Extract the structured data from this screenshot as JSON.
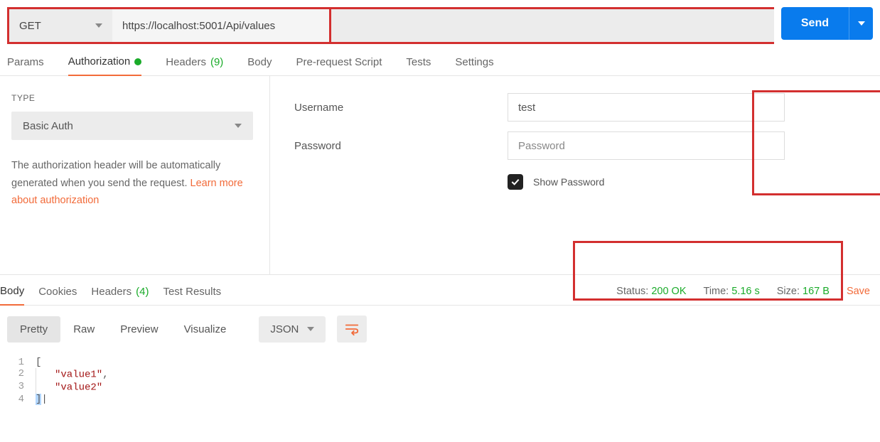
{
  "request": {
    "method": "GET",
    "url": "https://localhost:5001/Api/values",
    "send_label": "Send"
  },
  "tabs": {
    "params": "Params",
    "authorization": "Authorization",
    "headers": "Headers",
    "headers_count": "(9)",
    "body": "Body",
    "prerequest": "Pre-request Script",
    "tests": "Tests",
    "settings": "Settings"
  },
  "auth": {
    "type_label": "TYPE",
    "type_value": "Basic Auth",
    "desc1": "The authorization header will be automatically generated when you send the request. ",
    "learn": "Learn more about authorization",
    "username_label": "Username",
    "username_value": "test",
    "password_label": "Password",
    "password_placeholder": "Password",
    "show_pw_label": "Show Password"
  },
  "response": {
    "tabs": {
      "body": "Body",
      "cookies": "Cookies",
      "headers": "Headers",
      "headers_count": "(4)",
      "tests": "Test Results"
    },
    "status_label": "Status:",
    "status_value": "200 OK",
    "time_label": "Time:",
    "time_value": "5.16 s",
    "size_label": "Size:",
    "size_value": "167 B",
    "save": "Save"
  },
  "viewer": {
    "pretty": "Pretty",
    "raw": "Raw",
    "preview": "Preview",
    "visualize": "Visualize",
    "format": "JSON"
  },
  "code": {
    "l1": "[",
    "l2a": "\"value1\"",
    "l2b": ",",
    "l3": "\"value2\"",
    "l4": "]"
  }
}
